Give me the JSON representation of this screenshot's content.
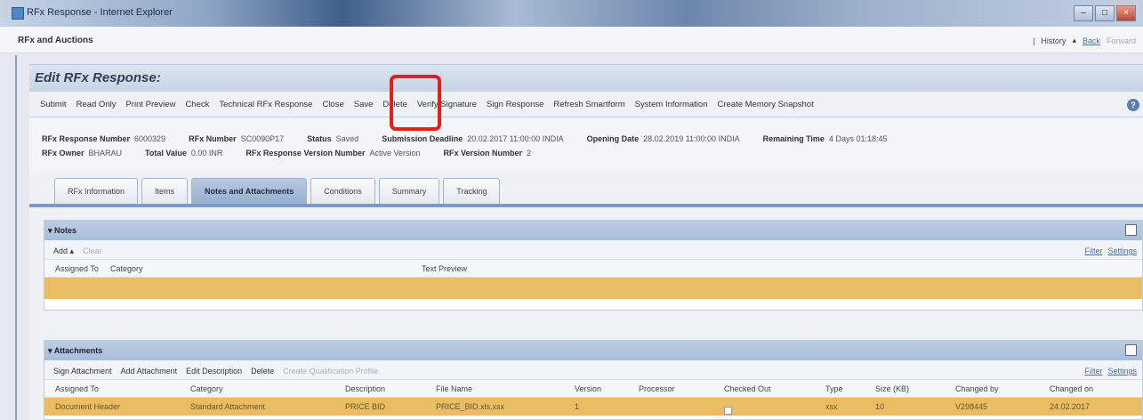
{
  "window": {
    "title": "RFx Response - Internet Explorer",
    "buttons": [
      "–",
      "□",
      "×"
    ]
  },
  "menubar": {
    "breadcrumb": "RFx and Auctions",
    "history": "History",
    "back": "Back",
    "forward": "Forward"
  },
  "page": {
    "title": "Edit RFx Response:"
  },
  "toolbar": {
    "buttons": [
      "Submit",
      "Read Only",
      "Print Preview",
      "Check",
      "Technical RFx Response",
      "Close",
      "Save",
      "Delete",
      "Verify Signature",
      "Sign Response",
      "Refresh Smartform",
      "System Information",
      "Create Memory Snapshot"
    ],
    "help": "?"
  },
  "header": {
    "row1": [
      {
        "label": "RFx Response Number",
        "value": "6000329"
      },
      {
        "label": "RFx Number",
        "value": "SC0090P17"
      },
      {
        "label": "Status",
        "value": "Saved"
      },
      {
        "label": "Submission Deadline",
        "value": "20.02.2017 11:00:00 INDIA"
      },
      {
        "label": "Opening Date",
        "value": "28.02.2019 11:00:00 INDIA"
      },
      {
        "label": "Remaining Time",
        "value": "4 Days 01:18:45"
      }
    ],
    "row2": [
      {
        "label": "RFx Owner",
        "value": "BHARAU"
      },
      {
        "label": "Total Value",
        "value": "0.00 INR"
      },
      {
        "label": "RFx Response Version Number",
        "value": "Active Version"
      },
      {
        "label": "RFx Version Number",
        "value": "2"
      }
    ]
  },
  "tabs": [
    "RFx Information",
    "Items",
    "Notes and Attachments",
    "Conditions",
    "Summary",
    "Tracking"
  ],
  "active_tab": "Notes and Attachments",
  "notes": {
    "title": "Notes",
    "add": "Add",
    "clear": "Clear",
    "filter": "Filter",
    "settings": "Settings",
    "columns": [
      "Assigned To",
      "Category",
      "Text Preview"
    ]
  },
  "attachments": {
    "title": "Attachments",
    "actions": [
      "Sign Attachment",
      "Add Attachment",
      "Edit Description",
      "Delete"
    ],
    "disabled_action": "Create Qualification Profile",
    "filter": "Filter",
    "settings": "Settings",
    "columns": [
      "Assigned To",
      "Category",
      "Description",
      "File Name",
      "Version",
      "Processor",
      "Checked Out",
      "Type",
      "Size (KB)",
      "Changed by",
      "Changed on"
    ],
    "row": {
      "assigned_to": "Document Header",
      "category": "Standard Attachment",
      "description": "PRICE BID",
      "file_name": "PRICE_BID.xls.xsx",
      "version": "1",
      "processor": "",
      "type": "xsx",
      "size": "10",
      "changed_by": "V298445",
      "changed_on": "24.02.2017"
    }
  },
  "colors": {
    "highlight_box": "#e0201a",
    "row_highlight": "#e9bd63",
    "panel_header": "#a7bdd9"
  }
}
